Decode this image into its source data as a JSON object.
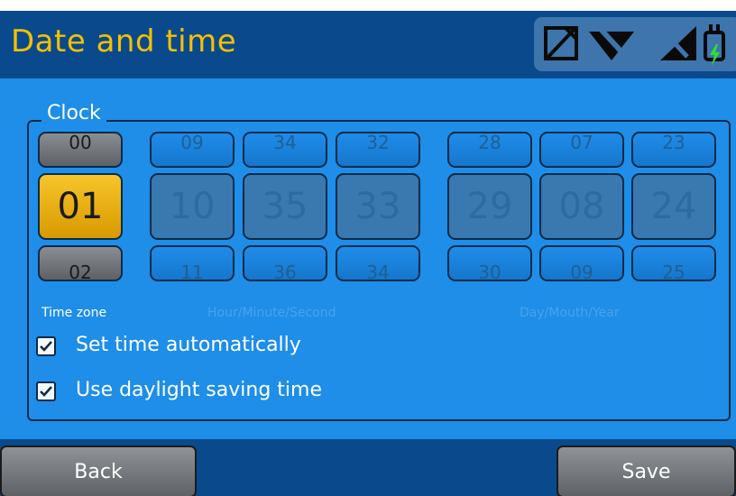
{
  "header": {
    "title": "Date and time",
    "status_icons": [
      "sim-card-off-icon",
      "wifi-off-icon",
      "cellular-signal-off-icon",
      "battery-charging-icon"
    ]
  },
  "clock": {
    "legend": "Clock",
    "time_zone": {
      "prev": "00",
      "current": "01",
      "next": "02",
      "caption": "Time zone"
    },
    "time": {
      "caption": "Hour/Minute/Second",
      "hour": {
        "prev": "09",
        "current": "10",
        "next": "11"
      },
      "minute": {
        "prev": "34",
        "current": "35",
        "next": "36"
      },
      "second": {
        "prev": "32",
        "current": "33",
        "next": "34"
      }
    },
    "date": {
      "caption": "Day/Mouth/Year",
      "day": {
        "prev": "28",
        "current": "29",
        "next": "30"
      },
      "month": {
        "prev": "07",
        "current": "08",
        "next": "09"
      },
      "year": {
        "prev": "23",
        "current": "24",
        "next": "25"
      }
    }
  },
  "options": {
    "set_time_automatically": {
      "label": "Set time automatically",
      "checked": true
    },
    "use_daylight_saving": {
      "label": "Use daylight saving time",
      "checked": true
    }
  },
  "footer": {
    "back_label": "Back",
    "save_label": "Save"
  },
  "colors": {
    "accent_title": "#f5c000",
    "screen_blue": "#1e8ee8",
    "bar_dark_blue": "#0a4a8c",
    "selected_yellow": "#f0b400",
    "charging_green": "#33dd33"
  }
}
